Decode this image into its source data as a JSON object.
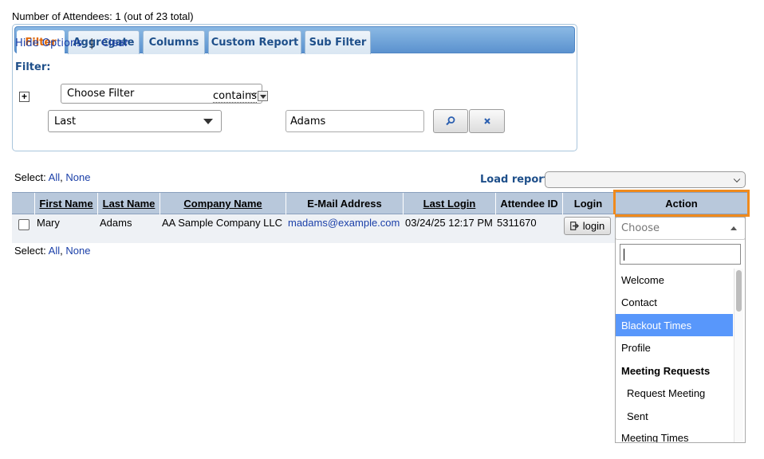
{
  "header": {
    "count_text": "Number of Attendees: 1 (out of 23 total)"
  },
  "tabs": [
    {
      "label": "Filter",
      "active": true
    },
    {
      "label": "Aggregate",
      "active": false
    },
    {
      "label": "Columns",
      "active": false
    },
    {
      "label": "Custom Report",
      "active": false
    },
    {
      "label": "Sub Filter",
      "active": false
    }
  ],
  "options": {
    "hide_label": "Hide Options",
    "separator": "|",
    "clear_label": "Clear"
  },
  "filter": {
    "label": "Filter:",
    "choose_value": "Choose Filter",
    "plus": "+",
    "field_value": "Last",
    "operator": "contains",
    "search_value": "Adams"
  },
  "select_top": {
    "label": "Select:",
    "all": "All",
    "comma": ",",
    "none": "None"
  },
  "load_report": {
    "label": "Load report:",
    "value": ""
  },
  "table": {
    "headers": [
      "First Name",
      "Last Name",
      "Company Name",
      "E-Mail Address",
      "Last Login",
      "Attendee ID",
      "Login",
      "Action"
    ],
    "row": {
      "first": "Mary",
      "last": "Adams",
      "company": "AA Sample Company LLC",
      "email": "madams@example.com",
      "last_login": "03/24/25 12:17 PM",
      "attendee_id": "5311670",
      "login_button": "login"
    }
  },
  "select_bottom": {
    "label": "Select:",
    "all": "All",
    "comma": ",",
    "none": "None"
  },
  "action_dropdown": {
    "placeholder": "Choose",
    "search_value": "",
    "items": [
      {
        "label": "Welcome",
        "type": "option"
      },
      {
        "label": "Contact",
        "type": "option"
      },
      {
        "label": "Blackout Times",
        "type": "option",
        "highlighted": true
      },
      {
        "label": "Profile",
        "type": "option"
      },
      {
        "label": "Meeting Requests",
        "type": "group"
      },
      {
        "label": "Request Meeting",
        "type": "sub"
      },
      {
        "label": "Sent",
        "type": "sub"
      },
      {
        "label": "Meeting Times",
        "type": "option"
      }
    ]
  },
  "colors": {
    "accent_tab": "#e06a0c",
    "highlight_border": "#f08a1c",
    "link": "#1a3fa8",
    "option_highlight": "#5897fb"
  }
}
